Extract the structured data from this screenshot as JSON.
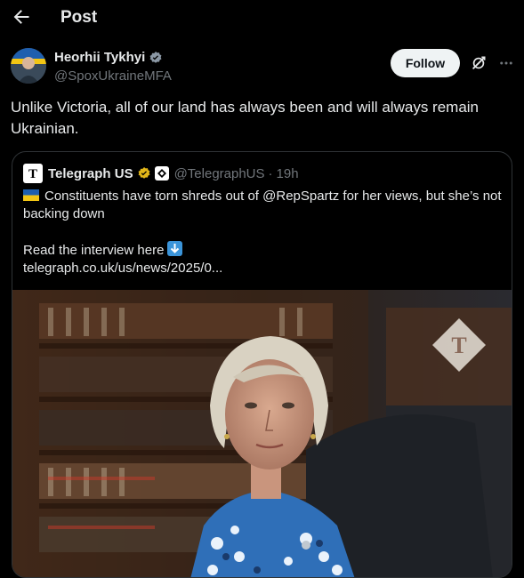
{
  "header": {
    "title": "Post",
    "back_icon": "arrow-left-icon"
  },
  "author": {
    "name": "Heorhii Tykhyi",
    "handle": "@SpoxUkraineMFA",
    "verified_color": "#8b98a5"
  },
  "actions": {
    "follow_label": "Follow",
    "grok_icon": "grok-icon",
    "more_icon": "more-icon"
  },
  "tweet": {
    "text": "Unlike Victoria, all of our land has always been and will always remain Ukrainian."
  },
  "quote": {
    "name": "Telegraph US",
    "handle": "@TelegraphUS",
    "separator": "·",
    "time": "19h",
    "line1": "Constituents have torn shreds out of @RepSpartz for her views, but she’s not backing down",
    "line2": "Read the interview here",
    "link": "telegraph.co.uk/us/news/2025/0...",
    "gold_color": "#e2b719"
  }
}
